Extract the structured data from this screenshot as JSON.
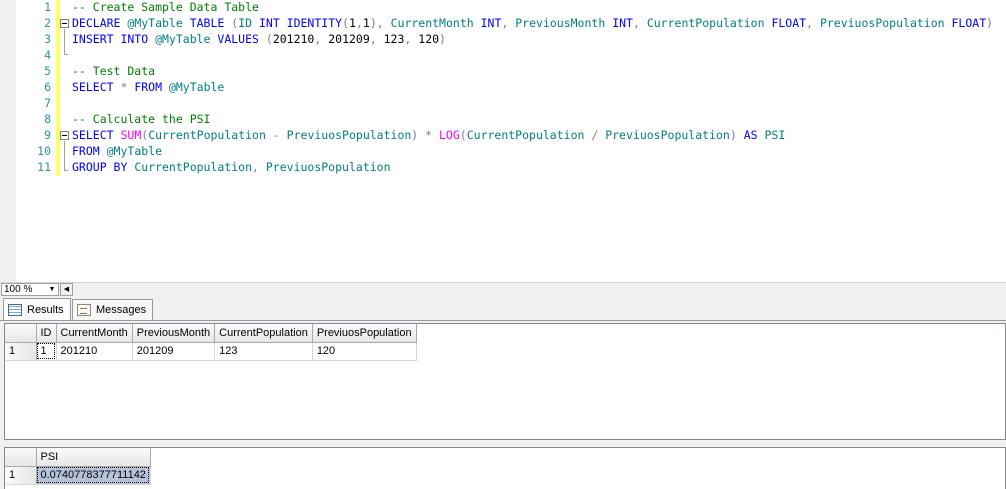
{
  "editor": {
    "line_numbers": [
      "1",
      "2",
      "3",
      "4",
      "5",
      "6",
      "7",
      "8",
      "9",
      "10",
      "11"
    ],
    "lines": [
      [
        {
          "t": "-- Create Sample Data Table",
          "c": "cm"
        }
      ],
      [
        {
          "t": "DECLARE ",
          "c": "kw"
        },
        {
          "t": "@MyTable ",
          "c": "id"
        },
        {
          "t": "TABLE ",
          "c": "kw"
        },
        {
          "t": "(",
          "c": "op"
        },
        {
          "t": "ID ",
          "c": "id"
        },
        {
          "t": "INT IDENTITY",
          "c": "kw"
        },
        {
          "t": "(",
          "c": "op"
        },
        {
          "t": "1",
          "c": "pl"
        },
        {
          "t": ",",
          "c": "op"
        },
        {
          "t": "1",
          "c": "pl"
        },
        {
          "t": "), ",
          "c": "op"
        },
        {
          "t": "CurrentMonth ",
          "c": "id"
        },
        {
          "t": "INT",
          "c": "kw"
        },
        {
          "t": ", ",
          "c": "op"
        },
        {
          "t": "PreviousMonth ",
          "c": "id"
        },
        {
          "t": "INT",
          "c": "kw"
        },
        {
          "t": ", ",
          "c": "op"
        },
        {
          "t": "CurrentPopulation ",
          "c": "id"
        },
        {
          "t": "FLOAT",
          "c": "kw"
        },
        {
          "t": ", ",
          "c": "op"
        },
        {
          "t": "PreviuosPopulation ",
          "c": "id"
        },
        {
          "t": "FLOAT",
          "c": "kw"
        },
        {
          "t": ")",
          "c": "op"
        }
      ],
      [
        {
          "t": "INSERT INTO ",
          "c": "kw"
        },
        {
          "t": "@MyTable ",
          "c": "id"
        },
        {
          "t": "VALUES ",
          "c": "kw"
        },
        {
          "t": "(",
          "c": "op"
        },
        {
          "t": "201210",
          "c": "pl"
        },
        {
          "t": ", ",
          "c": "op"
        },
        {
          "t": "201209",
          "c": "pl"
        },
        {
          "t": ", ",
          "c": "op"
        },
        {
          "t": "123",
          "c": "pl"
        },
        {
          "t": ", ",
          "c": "op"
        },
        {
          "t": "120",
          "c": "pl"
        },
        {
          "t": ")",
          "c": "op"
        }
      ],
      [],
      [
        {
          "t": "-- Test Data",
          "c": "cm"
        }
      ],
      [
        {
          "t": "SELECT ",
          "c": "kw"
        },
        {
          "t": "* ",
          "c": "op"
        },
        {
          "t": "FROM ",
          "c": "kw"
        },
        {
          "t": "@MyTable",
          "c": "id"
        }
      ],
      [],
      [
        {
          "t": "-- Calculate the PSI",
          "c": "cm"
        }
      ],
      [
        {
          "t": "SELECT ",
          "c": "kw"
        },
        {
          "t": "SUM",
          "c": "fn"
        },
        {
          "t": "(",
          "c": "op"
        },
        {
          "t": "CurrentPopulation ",
          "c": "id"
        },
        {
          "t": "- ",
          "c": "op"
        },
        {
          "t": "PreviuosPopulation",
          "c": "id"
        },
        {
          "t": ") * ",
          "c": "op"
        },
        {
          "t": "LOG",
          "c": "fn"
        },
        {
          "t": "(",
          "c": "op"
        },
        {
          "t": "CurrentPopulation ",
          "c": "id"
        },
        {
          "t": "/ ",
          "c": "op"
        },
        {
          "t": "PreviuosPopulation",
          "c": "id"
        },
        {
          "t": ") ",
          "c": "op"
        },
        {
          "t": "AS ",
          "c": "kw"
        },
        {
          "t": "PSI",
          "c": "id"
        }
      ],
      [
        {
          "t": "FROM ",
          "c": "kw"
        },
        {
          "t": "@MyTable",
          "c": "id"
        }
      ],
      [
        {
          "t": "GROUP BY ",
          "c": "kw"
        },
        {
          "t": "CurrentPopulation",
          "c": "id"
        },
        {
          "t": ", ",
          "c": "op"
        },
        {
          "t": "PreviuosPopulation",
          "c": "id"
        }
      ]
    ]
  },
  "zoom": {
    "value": "100 %"
  },
  "tabs": {
    "results": "Results",
    "messages": "Messages"
  },
  "grid1": {
    "headers": [
      "ID",
      "CurrentMonth",
      "PreviousMonth",
      "CurrentPopulation",
      "PreviuosPopulation"
    ],
    "rows": [
      {
        "num": "1",
        "cells": [
          "1",
          "201210",
          "201209",
          "123",
          "120"
        ]
      }
    ]
  },
  "grid2": {
    "headers": [
      "PSI"
    ],
    "rows": [
      {
        "num": "1",
        "cells": [
          "0.0740778377711142"
        ]
      }
    ]
  },
  "colors": {
    "keyword": "#0000ff",
    "comment": "#008000",
    "function": "#ff00ff",
    "identifier": "#008080",
    "line_number": "#2b91af",
    "change_bar": "#ffff66"
  }
}
